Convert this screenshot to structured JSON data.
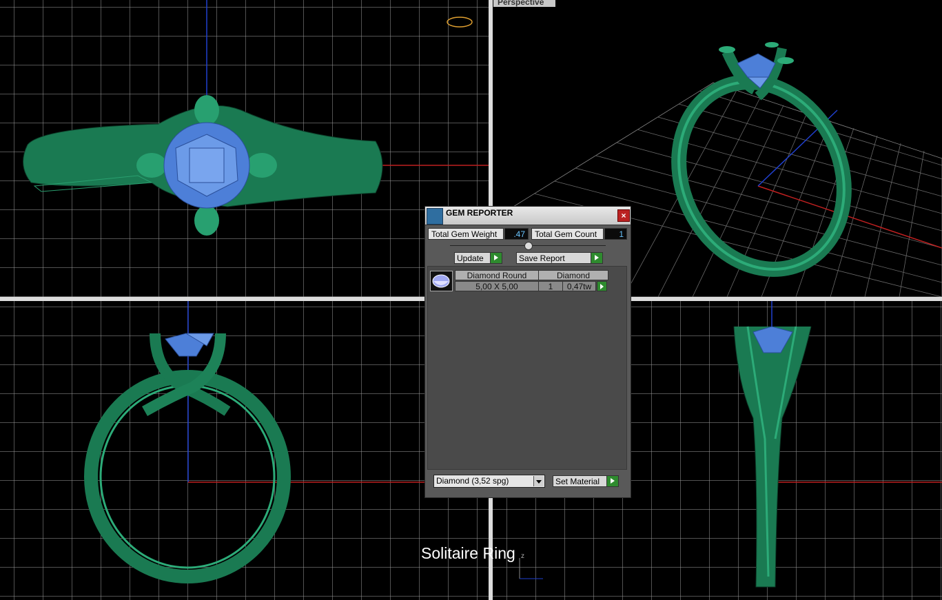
{
  "viewports": {
    "perspective_label": "Perspective"
  },
  "caption": "Solitaire Ring",
  "axis_label": "z",
  "dialog": {
    "title": "GEM REPORTER",
    "close_symbol": "×",
    "total_weight_label": "Total Gem Weight",
    "total_weight_value": ".47",
    "total_count_label": "Total Gem Count",
    "total_count_value": "1",
    "update_label": "Update",
    "save_report_label": "Save Report",
    "table": {
      "col1_header": "Diamond Round",
      "col2_header": "Diamond",
      "row": {
        "size": "5,00 X 5,00",
        "count": "1",
        "weight": "0,47tw"
      }
    },
    "material_select": "Diamond    (3,52 spg)",
    "set_material_label": "Set Material"
  },
  "colors": {
    "ring_green": "#1f8a5c",
    "gem_blue": "#4d7fd8",
    "axis_red": "#c02020",
    "axis_blue": "#2040d0"
  }
}
